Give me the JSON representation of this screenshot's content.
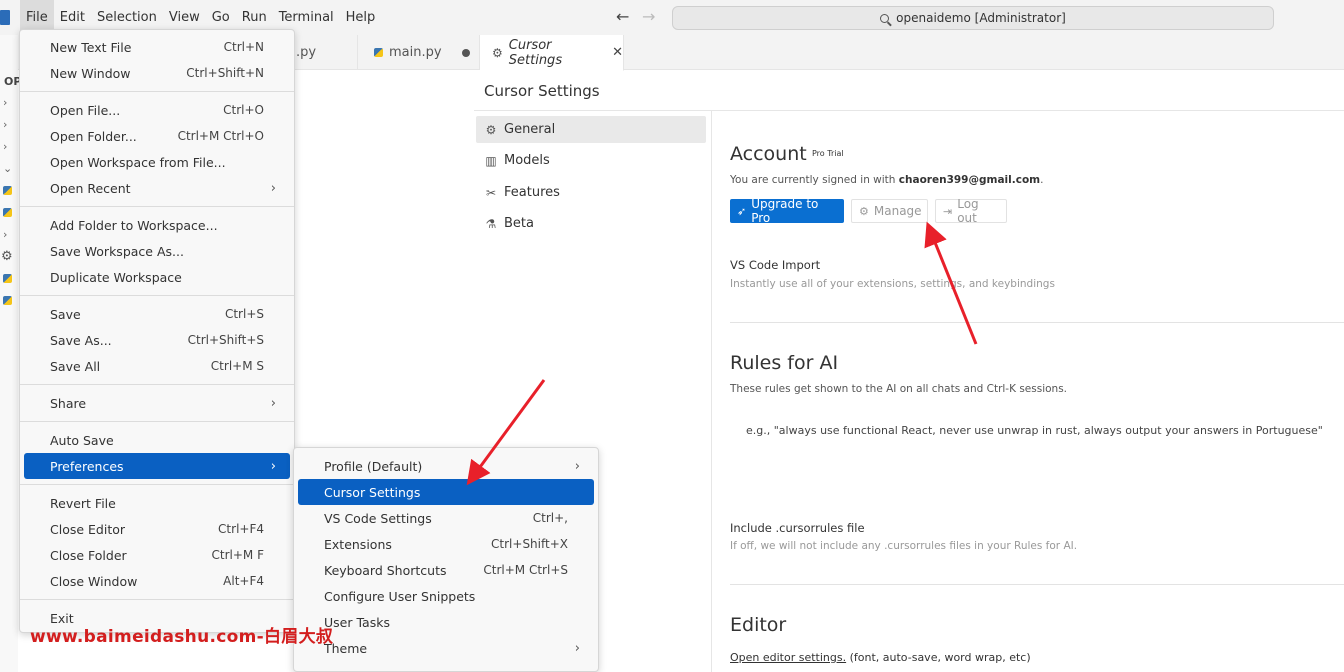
{
  "titlebar": {
    "menus": [
      "File",
      "Edit",
      "Selection",
      "View",
      "Go",
      "Run",
      "Terminal",
      "Help"
    ],
    "search_text": "openaidemo [Administrator]"
  },
  "explorer": {
    "label": "OP"
  },
  "tabs": [
    {
      "label": ".py"
    },
    {
      "label": "main.py"
    },
    {
      "label": "Cursor Settings"
    }
  ],
  "settings": {
    "title": "Cursor Settings",
    "nav": [
      {
        "label": "General",
        "icon": "gear-icon"
      },
      {
        "label": "Models",
        "icon": "bar-chart-icon"
      },
      {
        "label": "Features",
        "icon": "tools-icon"
      },
      {
        "label": "Beta",
        "icon": "flask-icon"
      }
    ],
    "account": {
      "title": "Account",
      "badge": "Pro Trial",
      "signed_in_prefix": "You are currently signed in with ",
      "email": "chaoren399@gmail.com",
      "signed_in_suffix": ".",
      "upgrade_label": "Upgrade to Pro",
      "manage_label": "Manage",
      "logout_label": "Log out"
    },
    "vscode_import": {
      "title": "VS Code Import",
      "desc": "Instantly use all of your extensions, settings, and keybindings"
    },
    "rules": {
      "title": "Rules for AI",
      "desc": "These rules get shown to the AI on all chats and Ctrl-K sessions.",
      "placeholder": "e.g., \"always use functional React, never use unwrap in rust, always output your answers in Portuguese\""
    },
    "cursorrules": {
      "title": "Include .cursorrules file",
      "desc": "If off, we will not include any .cursorrules files in your Rules for AI."
    },
    "editor": {
      "title": "Editor",
      "link": "Open editor settings.",
      "link_suffix": " (font, auto-save, word wrap, etc)"
    }
  },
  "file_menu": [
    {
      "label": "New Text File",
      "key": "Ctrl+N"
    },
    {
      "label": "New Window",
      "key": "Ctrl+Shift+N"
    },
    {
      "label": "Open File...",
      "key": "Ctrl+O"
    },
    {
      "label": "Open Folder...",
      "key": "Ctrl+M Ctrl+O"
    },
    {
      "label": "Open Workspace from File...",
      "key": ""
    },
    {
      "label": "Open Recent",
      "key": ""
    },
    {
      "label": "Add Folder to Workspace...",
      "key": ""
    },
    {
      "label": "Save Workspace As...",
      "key": ""
    },
    {
      "label": "Duplicate Workspace",
      "key": ""
    },
    {
      "label": "Save",
      "key": "Ctrl+S"
    },
    {
      "label": "Save As...",
      "key": "Ctrl+Shift+S"
    },
    {
      "label": "Save All",
      "key": "Ctrl+M S"
    },
    {
      "label": "Share",
      "key": ""
    },
    {
      "label": "Auto Save",
      "key": ""
    },
    {
      "label": "Preferences",
      "key": ""
    },
    {
      "label": "Revert File",
      "key": ""
    },
    {
      "label": "Close Editor",
      "key": "Ctrl+F4"
    },
    {
      "label": "Close Folder",
      "key": "Ctrl+M F"
    },
    {
      "label": "Close Window",
      "key": "Alt+F4"
    },
    {
      "label": "Exit",
      "key": ""
    }
  ],
  "preferences_menu": [
    {
      "label": "Profile (Default)",
      "key": ""
    },
    {
      "label": "Cursor Settings",
      "key": ""
    },
    {
      "label": "VS Code Settings",
      "key": "Ctrl+,"
    },
    {
      "label": "Extensions",
      "key": "Ctrl+Shift+X"
    },
    {
      "label": "Keyboard Shortcuts",
      "key": "Ctrl+M Ctrl+S"
    },
    {
      "label": "Configure User Snippets",
      "key": ""
    },
    {
      "label": "User Tasks",
      "key": ""
    },
    {
      "label": "Theme",
      "key": ""
    }
  ],
  "watermark": "www.baimeidashu.com-白眉大叔",
  "colors": {
    "accent": "#0a60c2",
    "primary_button": "#0a6fd1",
    "annotation_arrow": "#e8202a"
  }
}
